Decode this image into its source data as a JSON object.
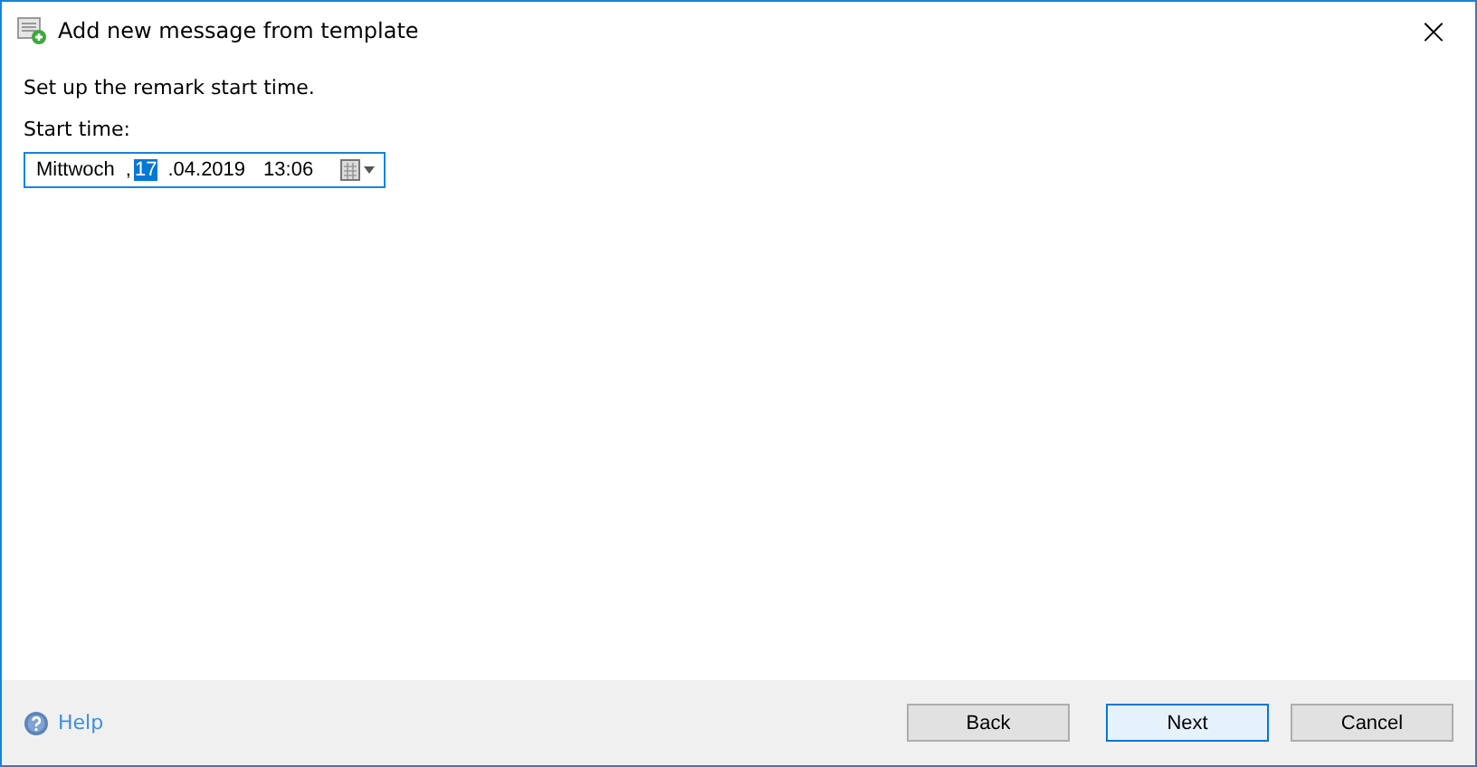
{
  "window": {
    "title": "Add new message from template",
    "close": "×"
  },
  "instruction": "Set up the remark start time.",
  "start_time": {
    "label": "Start time:",
    "segments": [
      {
        "text": "Mittwoch",
        "selected": false
      },
      {
        "text": ",",
        "selected": false
      },
      {
        "text": "17",
        "selected": true
      },
      {
        "text": ".04.2019",
        "selected": false
      },
      {
        "text": "13:06",
        "selected": false
      }
    ]
  },
  "footer": {
    "help": "Help",
    "buttons": [
      {
        "label": "Back",
        "focused": false
      },
      {
        "label": "Next",
        "focused": true
      },
      {
        "label": "Cancel",
        "focused": false
      }
    ]
  }
}
